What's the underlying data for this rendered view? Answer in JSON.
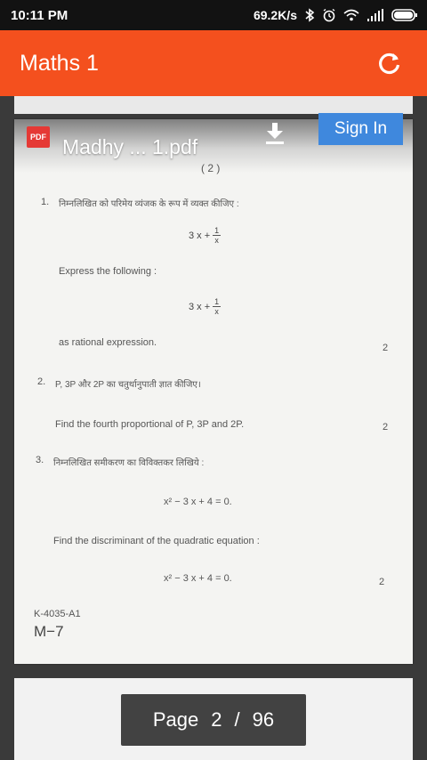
{
  "status": {
    "time": "10:11 PM",
    "speed": "69.2K/s"
  },
  "appbar": {
    "title": "Maths 1"
  },
  "docbar": {
    "pdf_badge": "PDF",
    "filename": "Madhy ... 1.pdf",
    "sign_in": "Sign In"
  },
  "document": {
    "page_marker": "( 2 )",
    "q1": {
      "num": "1.",
      "hindi": "निम्नलिखित को परिमेय व्यंजक के रूप में व्यक्त कीजिए :",
      "expr_lhs": "3 x +",
      "frac_num": "1",
      "frac_den": "x",
      "english": "Express the following :",
      "english2": "as rational expression.",
      "marks": "2"
    },
    "q2": {
      "num": "2.",
      "hindi": "P, 3P और 2P का चतुर्थानुपाती ज्ञात कीजिए।",
      "english": "Find the fourth proportional of P, 3P and 2P.",
      "marks": "2"
    },
    "q3": {
      "num": "3.",
      "hindi": "निम्नलिखित समीकरण का विविक्तकर लिखिये :",
      "equation": "x² − 3 x + 4 = 0.",
      "english": "Find the discriminant of the quadratic equation :",
      "marks": "2"
    },
    "footer_code": "K-4035-A1",
    "footer_m": "M−7"
  },
  "pager": {
    "label": "Page",
    "current": "2",
    "separator": "/",
    "total": "96"
  }
}
